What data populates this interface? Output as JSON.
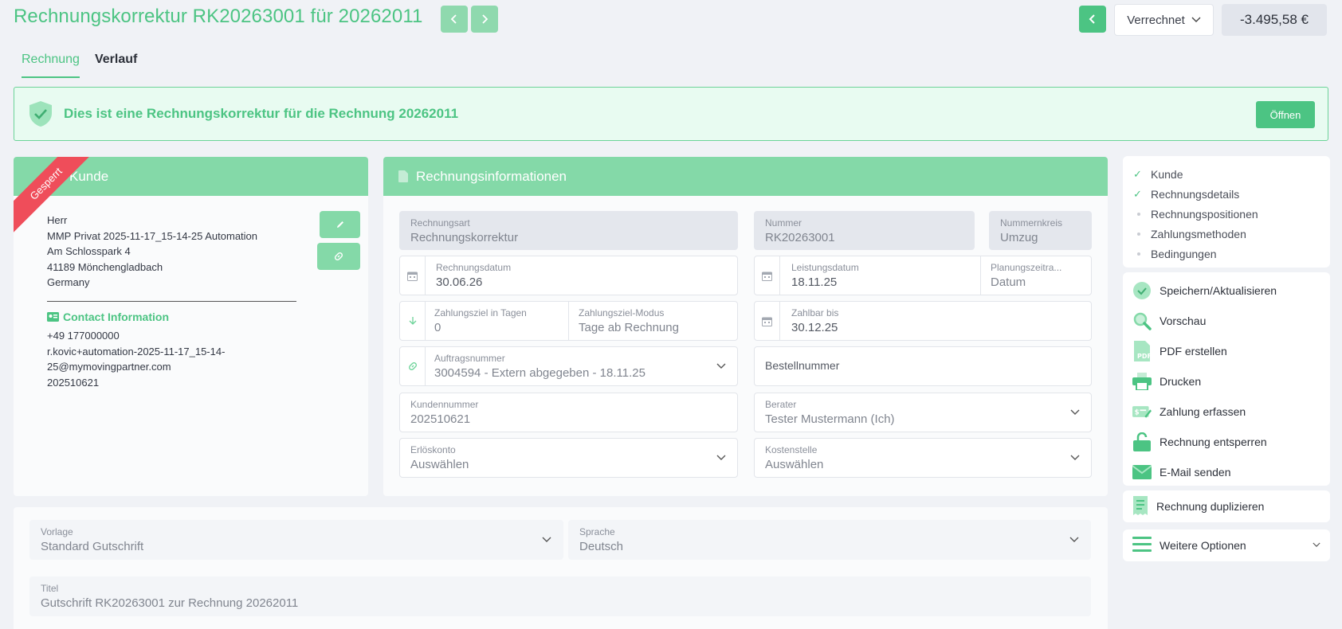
{
  "header": {
    "title": "Rechnungskorrektur RK20263001 für 20262011",
    "status": "Verrechnet",
    "amount": "-3.495,58 €"
  },
  "tabs": [
    {
      "label": "Rechnung",
      "active": true
    },
    {
      "label": "Verlauf",
      "active": false
    }
  ],
  "banner": {
    "text": "Dies ist eine Rechnungskorrektur für die Rechnung 20262011",
    "button": "Öffnen"
  },
  "customer": {
    "title": "Kunde",
    "ribbon": "Gesperrt",
    "salutation": "Herr",
    "name": "MMP Privat 2025-11-17_15-14-25 Automation",
    "street": "Am Schlosspark 4",
    "city": "41189 Mönchengladbach",
    "country": "Germany",
    "contact_heading": "Contact Information",
    "phone": "+49 177000000",
    "email_line1": "r.kovic+automation-2025-11-17_15-14-",
    "email_line2": "25@mymovingpartner.com",
    "customer_number": "202510621"
  },
  "invoice": {
    "title": "Rechnungsinformationen",
    "rechnungsart": {
      "label": "Rechnungsart",
      "value": "Rechnungskorrektur"
    },
    "nummer": {
      "label": "Nummer",
      "value": "RK20263001"
    },
    "nummernkreis": {
      "label": "Nummernkreis",
      "value": "Umzug"
    },
    "rechnungsdatum": {
      "label": "Rechnungsdatum",
      "value": "30.06.26"
    },
    "leistungsdatum": {
      "label": "Leistungsdatum",
      "value": "18.11.25"
    },
    "planungszeitraum": {
      "label": "Planungszeitra...",
      "value": "Datum"
    },
    "zahlungsziel": {
      "label": "Zahlungsziel in Tagen",
      "value": "0"
    },
    "zahlungsziel_modus": {
      "label": "Zahlungsziel-Modus",
      "value": "Tage ab Rechnung"
    },
    "zahlbar_bis": {
      "label": "Zahlbar bis",
      "value": "30.12.25"
    },
    "auftragsnummer": {
      "label": "Auftragsnummer",
      "value": "3004594 - Extern abgegeben - 18.11.25"
    },
    "bestellnummer": {
      "placeholder": "Bestellnummer"
    },
    "kundennummer": {
      "label": "Kundennummer",
      "value": "202510621"
    },
    "berater": {
      "label": "Berater",
      "value": "Tester Mustermann (Ich)"
    },
    "erloeskonto": {
      "label": "Erlöskonto",
      "value": "Auswählen"
    },
    "kostenstelle": {
      "label": "Kostenstelle",
      "value": "Auswählen"
    }
  },
  "details": {
    "vorlage": {
      "label": "Vorlage",
      "value": "Standard Gutschrift"
    },
    "sprache": {
      "label": "Sprache",
      "value": "Deutsch"
    },
    "titel": {
      "label": "Titel",
      "value": "Gutschrift RK20263001 zur Rechnung 20262011"
    }
  },
  "steps": [
    {
      "label": "Kunde",
      "done": true
    },
    {
      "label": "Rechnungsdetails",
      "done": true
    },
    {
      "label": "Rechnungspositionen",
      "done": false
    },
    {
      "label": "Zahlungsmethoden",
      "done": false
    },
    {
      "label": "Bedingungen",
      "done": false
    }
  ],
  "actions": [
    {
      "label": "Speichern/Aktualisieren",
      "icon": "check-circle-icon"
    },
    {
      "label": "Vorschau",
      "icon": "magnifier-icon"
    },
    {
      "label": "PDF erstellen",
      "icon": "pdf-icon"
    },
    {
      "label": "Drucken",
      "icon": "printer-icon"
    },
    {
      "label": "Zahlung erfassen",
      "icon": "payment-icon"
    },
    {
      "label": "Rechnung entsperren",
      "icon": "unlock-icon"
    },
    {
      "label": "E-Mail senden",
      "icon": "envelope-icon"
    }
  ],
  "duplicate": {
    "label": "Rechnung duplizieren"
  },
  "more": {
    "label": "Weitere Optionen"
  },
  "colors": {
    "accent": "#4cc483",
    "header": "#84d9a8",
    "ribbon": "#ef4d5a"
  }
}
